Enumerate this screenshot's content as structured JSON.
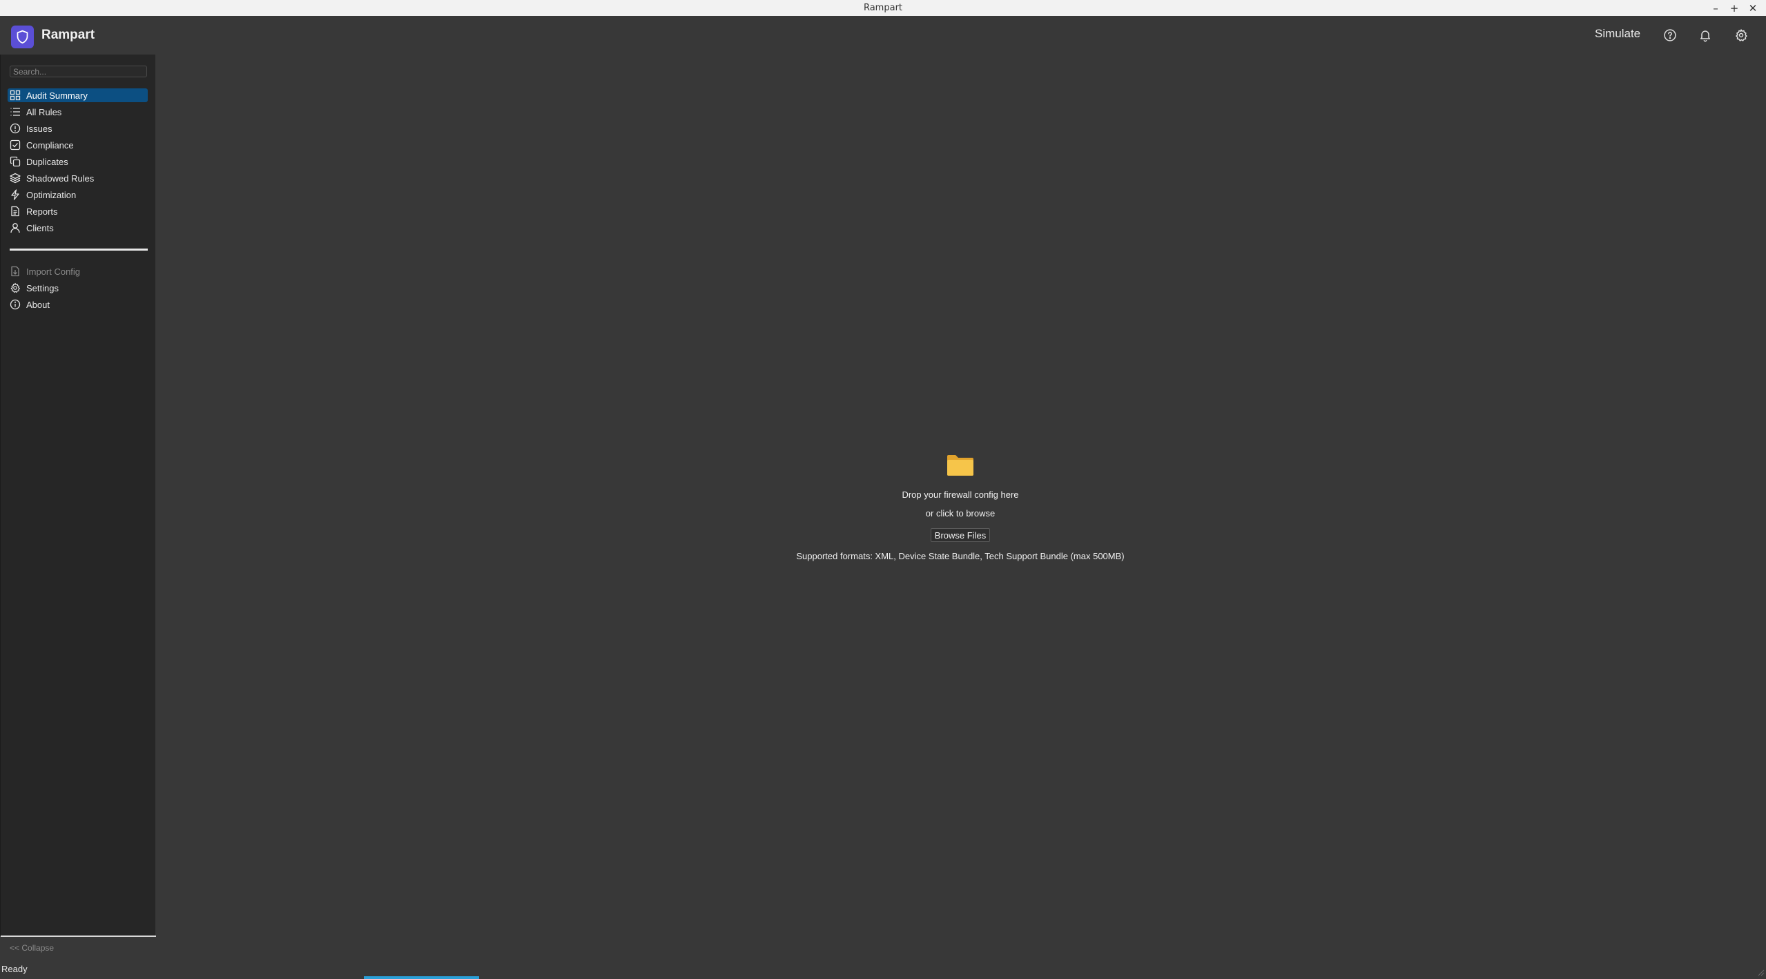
{
  "window": {
    "title": "Rampart"
  },
  "header": {
    "brand": "Rampart",
    "simulate_label": "Simulate"
  },
  "sidebar": {
    "search_placeholder": "Search...",
    "items": [
      {
        "label": "Audit Summary",
        "icon": "grid-icon",
        "active": true
      },
      {
        "label": "All Rules",
        "icon": "list-icon"
      },
      {
        "label": "Issues",
        "icon": "alert-circle-icon"
      },
      {
        "label": "Compliance",
        "icon": "checkbox-icon"
      },
      {
        "label": "Duplicates",
        "icon": "copy-icon"
      },
      {
        "label": "Shadowed Rules",
        "icon": "layers-icon"
      },
      {
        "label": "Optimization",
        "icon": "lightning-icon"
      },
      {
        "label": "Reports",
        "icon": "document-icon"
      },
      {
        "label": "Clients",
        "icon": "user-icon"
      }
    ],
    "secondary_items": [
      {
        "label": "Import Config",
        "icon": "file-import-icon",
        "disabled": true
      },
      {
        "label": "Settings",
        "icon": "gear-icon"
      },
      {
        "label": "About",
        "icon": "info-icon"
      }
    ],
    "collapse_label": "<< Collapse"
  },
  "dropzone": {
    "icon": "folder-icon",
    "primary_text": "Drop your firewall config here",
    "secondary_text": "or click to browse",
    "button_label": "Browse Files",
    "formats_text": "Supported formats: XML, Device State Bundle, Tech Support Bundle (max 500MB)"
  },
  "status": {
    "text": "Ready"
  },
  "colors": {
    "accent": "#0c4f82",
    "brand": "#5b4fd6",
    "progress": "#2aa0d8"
  }
}
